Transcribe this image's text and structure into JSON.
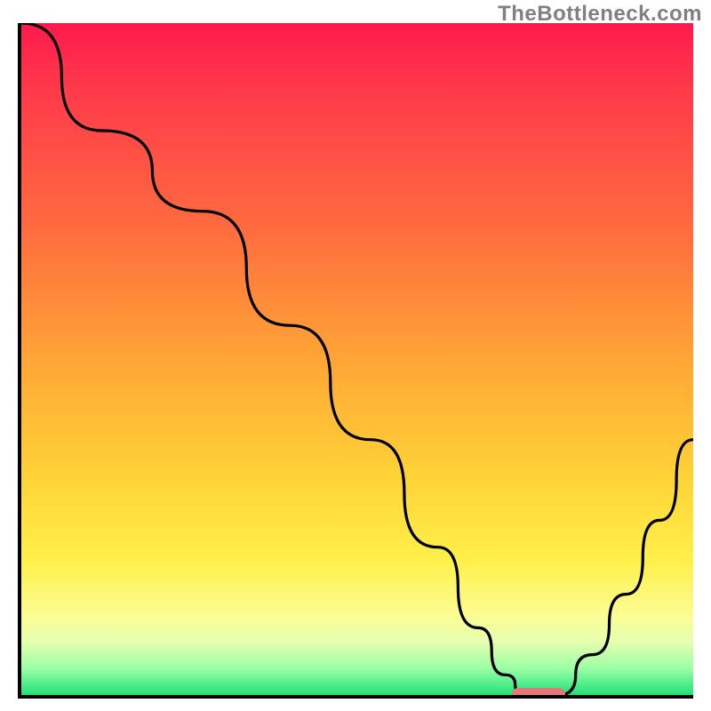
{
  "watermark": "TheBottleneck.com",
  "chart_data": {
    "type": "line",
    "title": "",
    "xlabel": "",
    "ylabel": "",
    "xlim": [
      0,
      100
    ],
    "ylim": [
      0,
      100
    ],
    "x": [
      0,
      12,
      27,
      40,
      52,
      62,
      68,
      72,
      75,
      80,
      85,
      90,
      95,
      100
    ],
    "values": [
      100,
      84,
      72,
      55,
      38,
      22,
      10,
      3,
      0,
      0,
      6,
      15,
      26,
      38
    ],
    "annotations": [
      {
        "kind": "marker",
        "x_start": 73,
        "x_end": 81,
        "y": 0,
        "color": "#e27a7a"
      }
    ],
    "background_gradient_stops": [
      {
        "pos": 0,
        "color": "#ff1a4d"
      },
      {
        "pos": 10,
        "color": "#ff3a4a"
      },
      {
        "pos": 30,
        "color": "#ff6a3f"
      },
      {
        "pos": 50,
        "color": "#ffa536"
      },
      {
        "pos": 68,
        "color": "#ffd437"
      },
      {
        "pos": 80,
        "color": "#fff04a"
      },
      {
        "pos": 88,
        "color": "#fcfc92"
      },
      {
        "pos": 92,
        "color": "#e6ffb0"
      },
      {
        "pos": 96,
        "color": "#9cffa6"
      },
      {
        "pos": 100,
        "color": "#22e07a"
      }
    ]
  }
}
